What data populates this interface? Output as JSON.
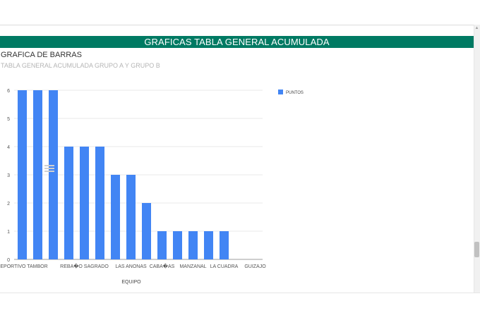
{
  "banner": {
    "title": "GRAFICAS TABLA GENERAL ACUMULADA"
  },
  "chart_data": {
    "type": "bar",
    "title": "GRAFICA DE BARRAS",
    "subtitle": "TABLA GENERAL ACUMULADA GRUPO A Y GRUPO B",
    "xlabel": "EQUIPO",
    "ylabel": "",
    "ylim": [
      0,
      6
    ],
    "yticks": [
      0,
      1,
      2,
      3,
      4,
      5,
      6
    ],
    "grid": true,
    "legend_position": "right",
    "categories": [
      "DEPORTIVO TAMBOR",
      "",
      "",
      "",
      "REBAñO SAGRADO",
      "",
      "",
      "LAS ANONAS",
      "",
      "CABAñAS",
      "",
      "MANZANAL",
      "",
      "LA CUADRA",
      "",
      "GUIZAJO"
    ],
    "x_tick_labels": [
      "DEPORTIVO TAMBOR",
      "REBA�O SAGRADO",
      "LAS ANONAS",
      "CABA�AS",
      "MANZANAL",
      "LA CUADRA",
      "GUIZAJO"
    ],
    "x_tick_indices": [
      0,
      4,
      7,
      9,
      11,
      13,
      15
    ],
    "series": [
      {
        "name": "PUNTOS",
        "color": "#4285f4",
        "values": [
          6,
          6,
          6,
          4,
          4,
          4,
          3,
          3,
          2,
          1,
          1,
          1,
          1,
          1,
          0,
          0
        ]
      }
    ]
  }
}
